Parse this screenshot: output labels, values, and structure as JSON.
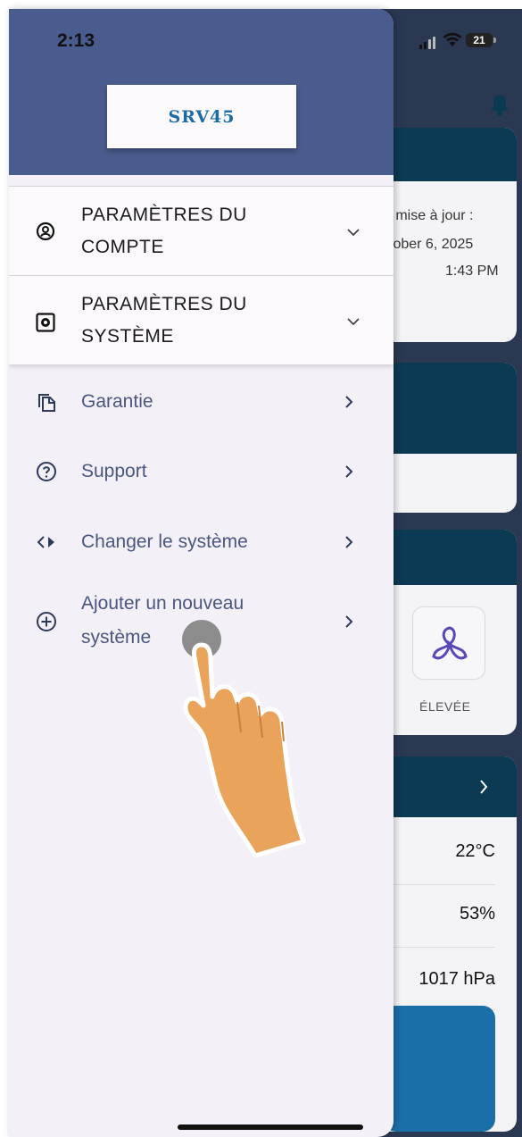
{
  "status_bar": {
    "time": "2:13",
    "battery": "21"
  },
  "drawer": {
    "logo": "SRV45",
    "expandable_sections": [
      {
        "line1": "PARAMÈTRES DU",
        "line2": "COMPTE"
      },
      {
        "line1": "PARAMÈTRES DU",
        "line2": "SYSTÈME"
      }
    ],
    "nav_items": [
      {
        "label": "Garantie"
      },
      {
        "label": "Support"
      },
      {
        "label": "Changer le système"
      },
      {
        "label_line1": "Ajouter un nouveau",
        "label_line2": "système"
      }
    ]
  },
  "background": {
    "last_update_label": "e mise à jour :",
    "last_update_date": "tober 6, 2025",
    "last_update_time": "1:43 PM",
    "fan_mode_label": "ÉLEVÉE",
    "temperature": "22°C",
    "humidity": "53%",
    "pressure": "1017 hPa"
  },
  "colors": {
    "drawer_header": "#4a5c8d",
    "drawer_bg": "#f3f1f7",
    "nav_text": "#4a5680",
    "logo": "#1b6ba6",
    "bg_band": "#0c3a52",
    "hand": "#e9a35a"
  }
}
